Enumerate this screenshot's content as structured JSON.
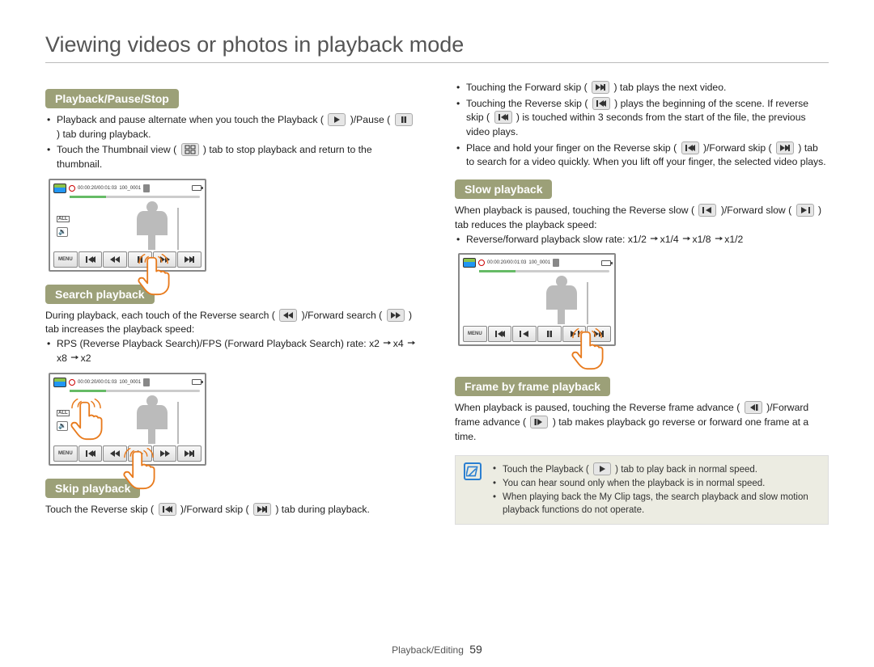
{
  "page": {
    "title": "Viewing videos or photos in playback mode",
    "footer_section": "Playback/Editing",
    "footer_page": "59"
  },
  "headings": {
    "playback_pause_stop": "Playback/Pause/Stop",
    "search_playback": "Search playback",
    "skip_playback": "Skip playback",
    "slow_playback": "Slow playback",
    "frame_by_frame": "Frame by frame playback"
  },
  "left": {
    "pps": {
      "li1a": "Playback and pause alternate when you touch the Playback (",
      "li1b": ")/Pause (",
      "li1c": ") tab during playback.",
      "li2a": "Touch the Thumbnail view (",
      "li2b": ") tab to stop playback and return to the thumbnail."
    },
    "search": {
      "intro_a": "During playback, each touch of the Reverse search (",
      "intro_b": ")/Forward search (",
      "intro_c": ") tab increases the playback speed:",
      "rate_label": "RPS (Reverse Playback Search)/FPS (Forward Playback Search) rate: x2",
      "r2": "x4",
      "r3": "x8",
      "r4": "x2"
    },
    "skip": {
      "intro_a": "Touch the Reverse skip (",
      "intro_b": ")/Forward skip (",
      "intro_c": ") tab during playback."
    }
  },
  "right": {
    "skip": {
      "li1a": "Touching the Forward skip (",
      "li1b": ") tab plays the next video.",
      "li2a": "Touching the Reverse skip (",
      "li2b": ") plays the beginning of the scene. If reverse skip (",
      "li2c": ") is touched within 3 seconds from the start of the file, the previous video plays.",
      "li3a": "Place and hold your finger on the Reverse skip (",
      "li3b": ")/Forward skip (",
      "li3c": ") tab to search for a video quickly. When you lift off your finger, the selected video plays."
    },
    "slow": {
      "intro_a": "When playback is paused, touching the Reverse slow (",
      "intro_b": ")/Forward slow (",
      "intro_c": ") tab reduces the playback speed:",
      "rate_label": "Reverse/forward playback slow rate: x1/2",
      "r2": "x1/4",
      "r3": "x1/8",
      "r4": "x1/2"
    },
    "frame": {
      "intro_a": "When playback is paused, touching the Reverse frame advance (",
      "intro_b": ")/Forward frame advance (",
      "intro_c": ") tab makes playback go reverse or forward one frame at a time."
    }
  },
  "notes": {
    "n1a": "Touch the Playback (",
    "n1b": ") tab to play back in normal speed.",
    "n2": "You can hear sound only when the playback is in normal speed.",
    "n3": "When playing back the My Clip tags, the search playback and slow motion playback functions do not operate."
  },
  "screen": {
    "timecode": "00:00:20/00:01:03",
    "file_number": "100_0001",
    "all_label": "ALL",
    "menu_label": "MENU"
  }
}
